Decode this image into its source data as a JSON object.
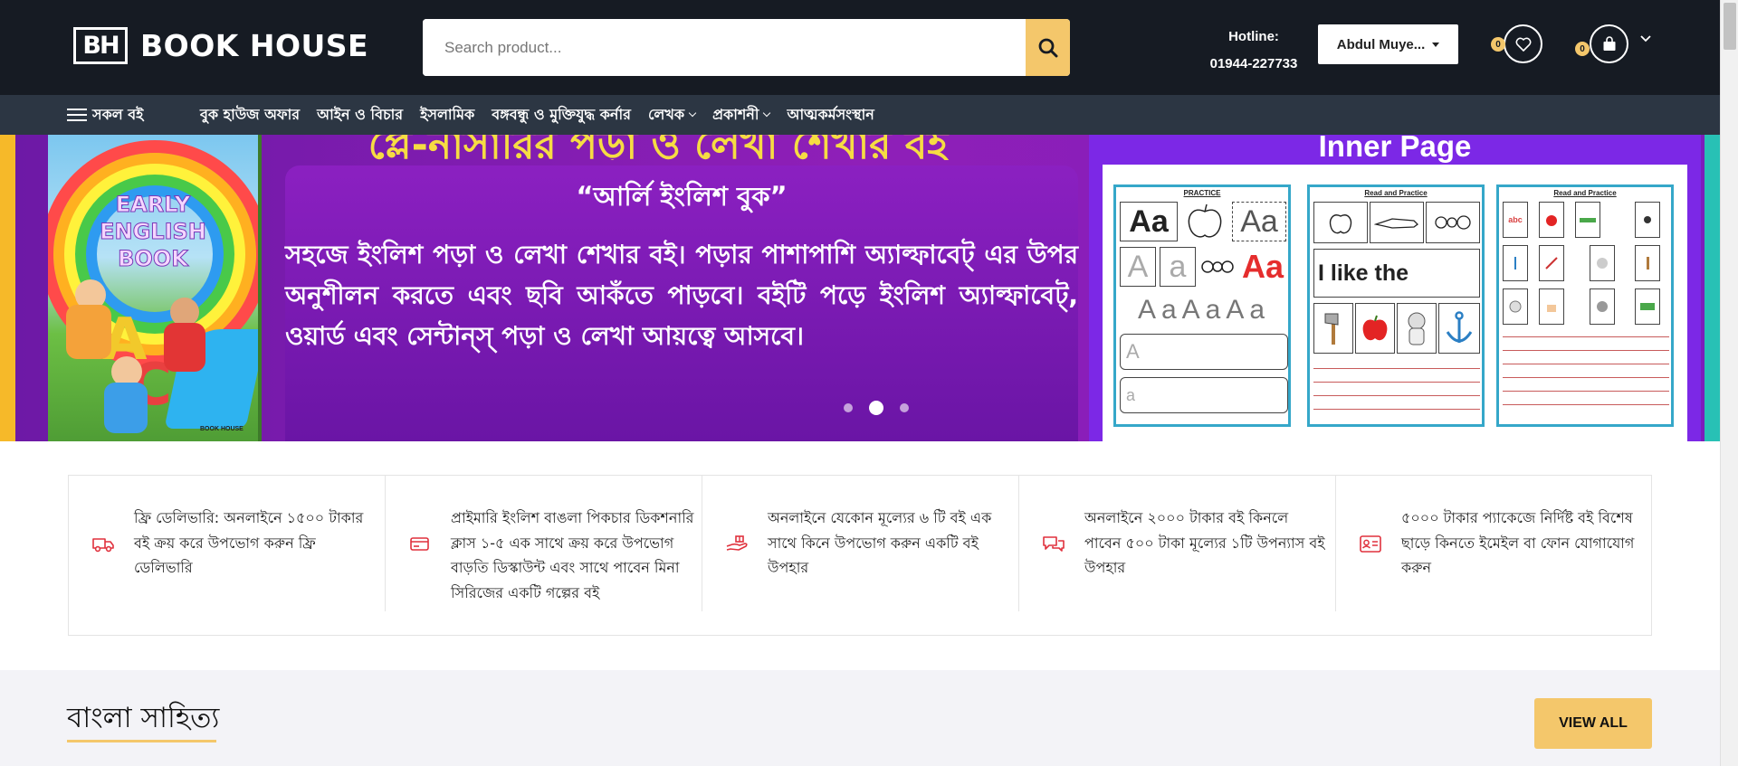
{
  "header": {
    "logo_mark": "BH",
    "logo_text": "BOOK HOUSE",
    "search_placeholder": "Search product...",
    "hotline_label": "Hotline:",
    "hotline_number": "01944-227733",
    "user_name": "Abdul Muye...",
    "wishlist_count": "0",
    "cart_count": "0"
  },
  "nav": {
    "all_books": "সকল বই",
    "links": [
      {
        "label": "বুক হাউজ অফার"
      },
      {
        "label": "আইন ও বিচার"
      },
      {
        "label": "ইসলামিক"
      },
      {
        "label": "বঙ্গবন্ধু ও মুক্তিযুদ্ধ কর্নার"
      },
      {
        "label": "লেখক"
      },
      {
        "label": "প্রকাশনী"
      },
      {
        "label": "আত্মকর্মসংস্থান"
      }
    ]
  },
  "banner": {
    "headline": "প্লে-নার্সারির পড়া ও লেখা শেখার বই",
    "card_title": "“আর্লি ইংলিশ বুক”",
    "card_body": "সহজে ইংলিশ পড়া ও লেখা শেখার বই। পড়ার পাশাপাশি অ্যাল্ফাবেট্ এর উপর অনুশীলন করতে এবং ছবি আকঁতে পাড়বে। বইটি পড়ে ইংলিশ অ্যাল্ফাবেট্, ওয়ার্ড এবং সেন্টান্স্ পড়া ও লেখা আয়ত্বে আসবে।",
    "book_title_1": "EARLY",
    "book_title_2": "ENGLISH",
    "book_title_3": "BOOK",
    "book_publisher": "BOOK HOUSE",
    "inner_title": "Inner Page",
    "page1_title": "PRACTICE",
    "page2_title": "Read and Practice",
    "page3_title": "Read and Practice",
    "page2_text": "I like the",
    "active_slide": 2,
    "slide_count": 3
  },
  "features": [
    {
      "icon": "delivery-truck-icon",
      "text": "ফ্রি ডেলিভারি: অনলাইনে ১৫০০ টাকার বই ক্রয় করে উপভোগ করুন ফ্রি ডেলিভারি"
    },
    {
      "icon": "credit-card-icon",
      "text": "প্রাইমারি ইংলিশ বাঙলা পিকচার ডিকশনারি ক্লাস ১-৫ এক সাথে ক্রয় করে উপভোগ বাড়তি ডিস্কাউন্ট এবং সাথে পাবেন মিনা সিরিজের একটি গল্পের বই"
    },
    {
      "icon": "gift-hand-icon",
      "text": "অনলাইনে যেকোন মূল্যের ৬ টি বই এক সাথে কিনে উপভোগ করুন একটি বই উপহার"
    },
    {
      "icon": "chat-bubbles-icon",
      "text": "অনলাইনে ২০০০ টাকার বই কিনলে পাবেন ৫০০ টাকা মূল্যের ১টি উপন্যাস বই উপহার"
    },
    {
      "icon": "id-card-icon",
      "text": "৫০০০ টাকার প্যাকেজে নির্দিষ্ট বই বিশেষ ছাড়ে কিনতে ইমেইল বা ফোন যোগাযোগ করুন"
    }
  ],
  "section": {
    "title": "বাংলা সাহিত্য",
    "view_all": "VIEW ALL"
  },
  "colors": {
    "header_bg": "#161b23",
    "nav_bg": "#2c3643",
    "accent": "#f4c76b",
    "feature_icon": "#e0313d"
  }
}
